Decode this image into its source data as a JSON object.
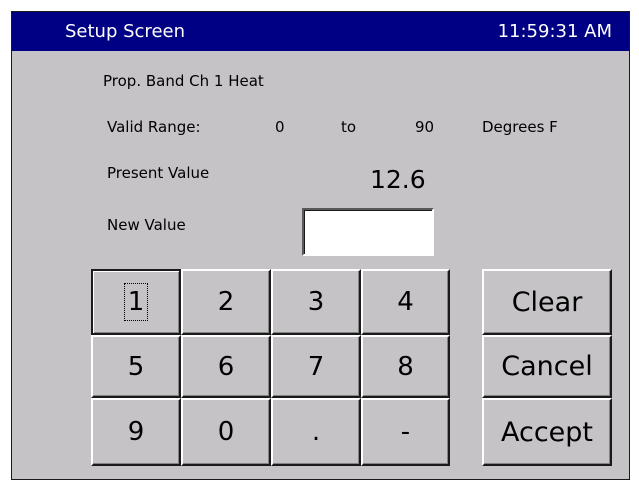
{
  "window": {
    "title": "Setup Screen",
    "clock": "11:59:31 AM"
  },
  "setpoint": {
    "parameter_name": "Prop. Band Ch 1 Heat",
    "valid_range_label": "Valid Range:",
    "range_min": "0",
    "range_to": "to",
    "range_max": "90",
    "units": "Degrees F",
    "present_value_label": "Present Value",
    "present_value": "12.6",
    "new_value_label": "New Value",
    "new_value": ""
  },
  "keypad": {
    "keys": [
      "1",
      "2",
      "3",
      "4",
      "5",
      "6",
      "7",
      "8",
      "9",
      "0",
      ".",
      "-"
    ]
  },
  "actions": {
    "clear": "Clear",
    "cancel": "Cancel",
    "accept": "Accept"
  },
  "colors": {
    "title_bar": "#000084",
    "panel": "#c6c3c6",
    "field": "#ffffff"
  }
}
